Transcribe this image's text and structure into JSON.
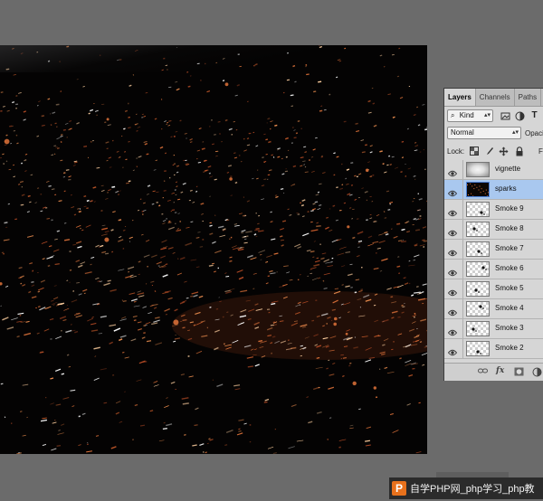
{
  "panel": {
    "tabs": [
      {
        "label": "Layers",
        "active": true
      },
      {
        "label": "Channels",
        "active": false
      },
      {
        "label": "Paths",
        "active": false
      }
    ],
    "filter_kind": "Kind",
    "blend_mode": "Normal",
    "opacity_label": "Opaci",
    "lock_label": "Lock:",
    "fill_label": "F",
    "layers": [
      {
        "name": "vignette",
        "visible": true,
        "selected": false,
        "thumb": "vignette"
      },
      {
        "name": "sparks",
        "visible": true,
        "selected": true,
        "thumb": "sparks"
      },
      {
        "name": "Smoke 9",
        "visible": true,
        "selected": false,
        "thumb": "smoke"
      },
      {
        "name": "Smoke 8",
        "visible": true,
        "selected": false,
        "thumb": "smoke"
      },
      {
        "name": "Smoke 7",
        "visible": true,
        "selected": false,
        "thumb": "smoke"
      },
      {
        "name": "Smoke 6",
        "visible": true,
        "selected": false,
        "thumb": "smoke"
      },
      {
        "name": "Smoke 5",
        "visible": true,
        "selected": false,
        "thumb": "smoke"
      },
      {
        "name": "Smoke 4",
        "visible": true,
        "selected": false,
        "thumb": "smoke"
      },
      {
        "name": "Smoke 3",
        "visible": true,
        "selected": false,
        "thumb": "smoke"
      },
      {
        "name": "Smoke 2",
        "visible": true,
        "selected": false,
        "thumb": "smoke"
      }
    ],
    "bottom_icons": [
      "link-icon",
      "fx-icon",
      "mask-icon",
      "adjustment-icon"
    ],
    "fx_label": "fx"
  },
  "watermark": {
    "logo": "P",
    "text": "自学PHP网_php学习_php教"
  },
  "colors": {
    "workspace": "#6b6b6b",
    "canvas": "#040303",
    "panel": "#d6d6d6",
    "selected_layer": "#a9c8ef",
    "spark_warm": "#e0733a",
    "spark_hot": "#ffd0a0"
  }
}
